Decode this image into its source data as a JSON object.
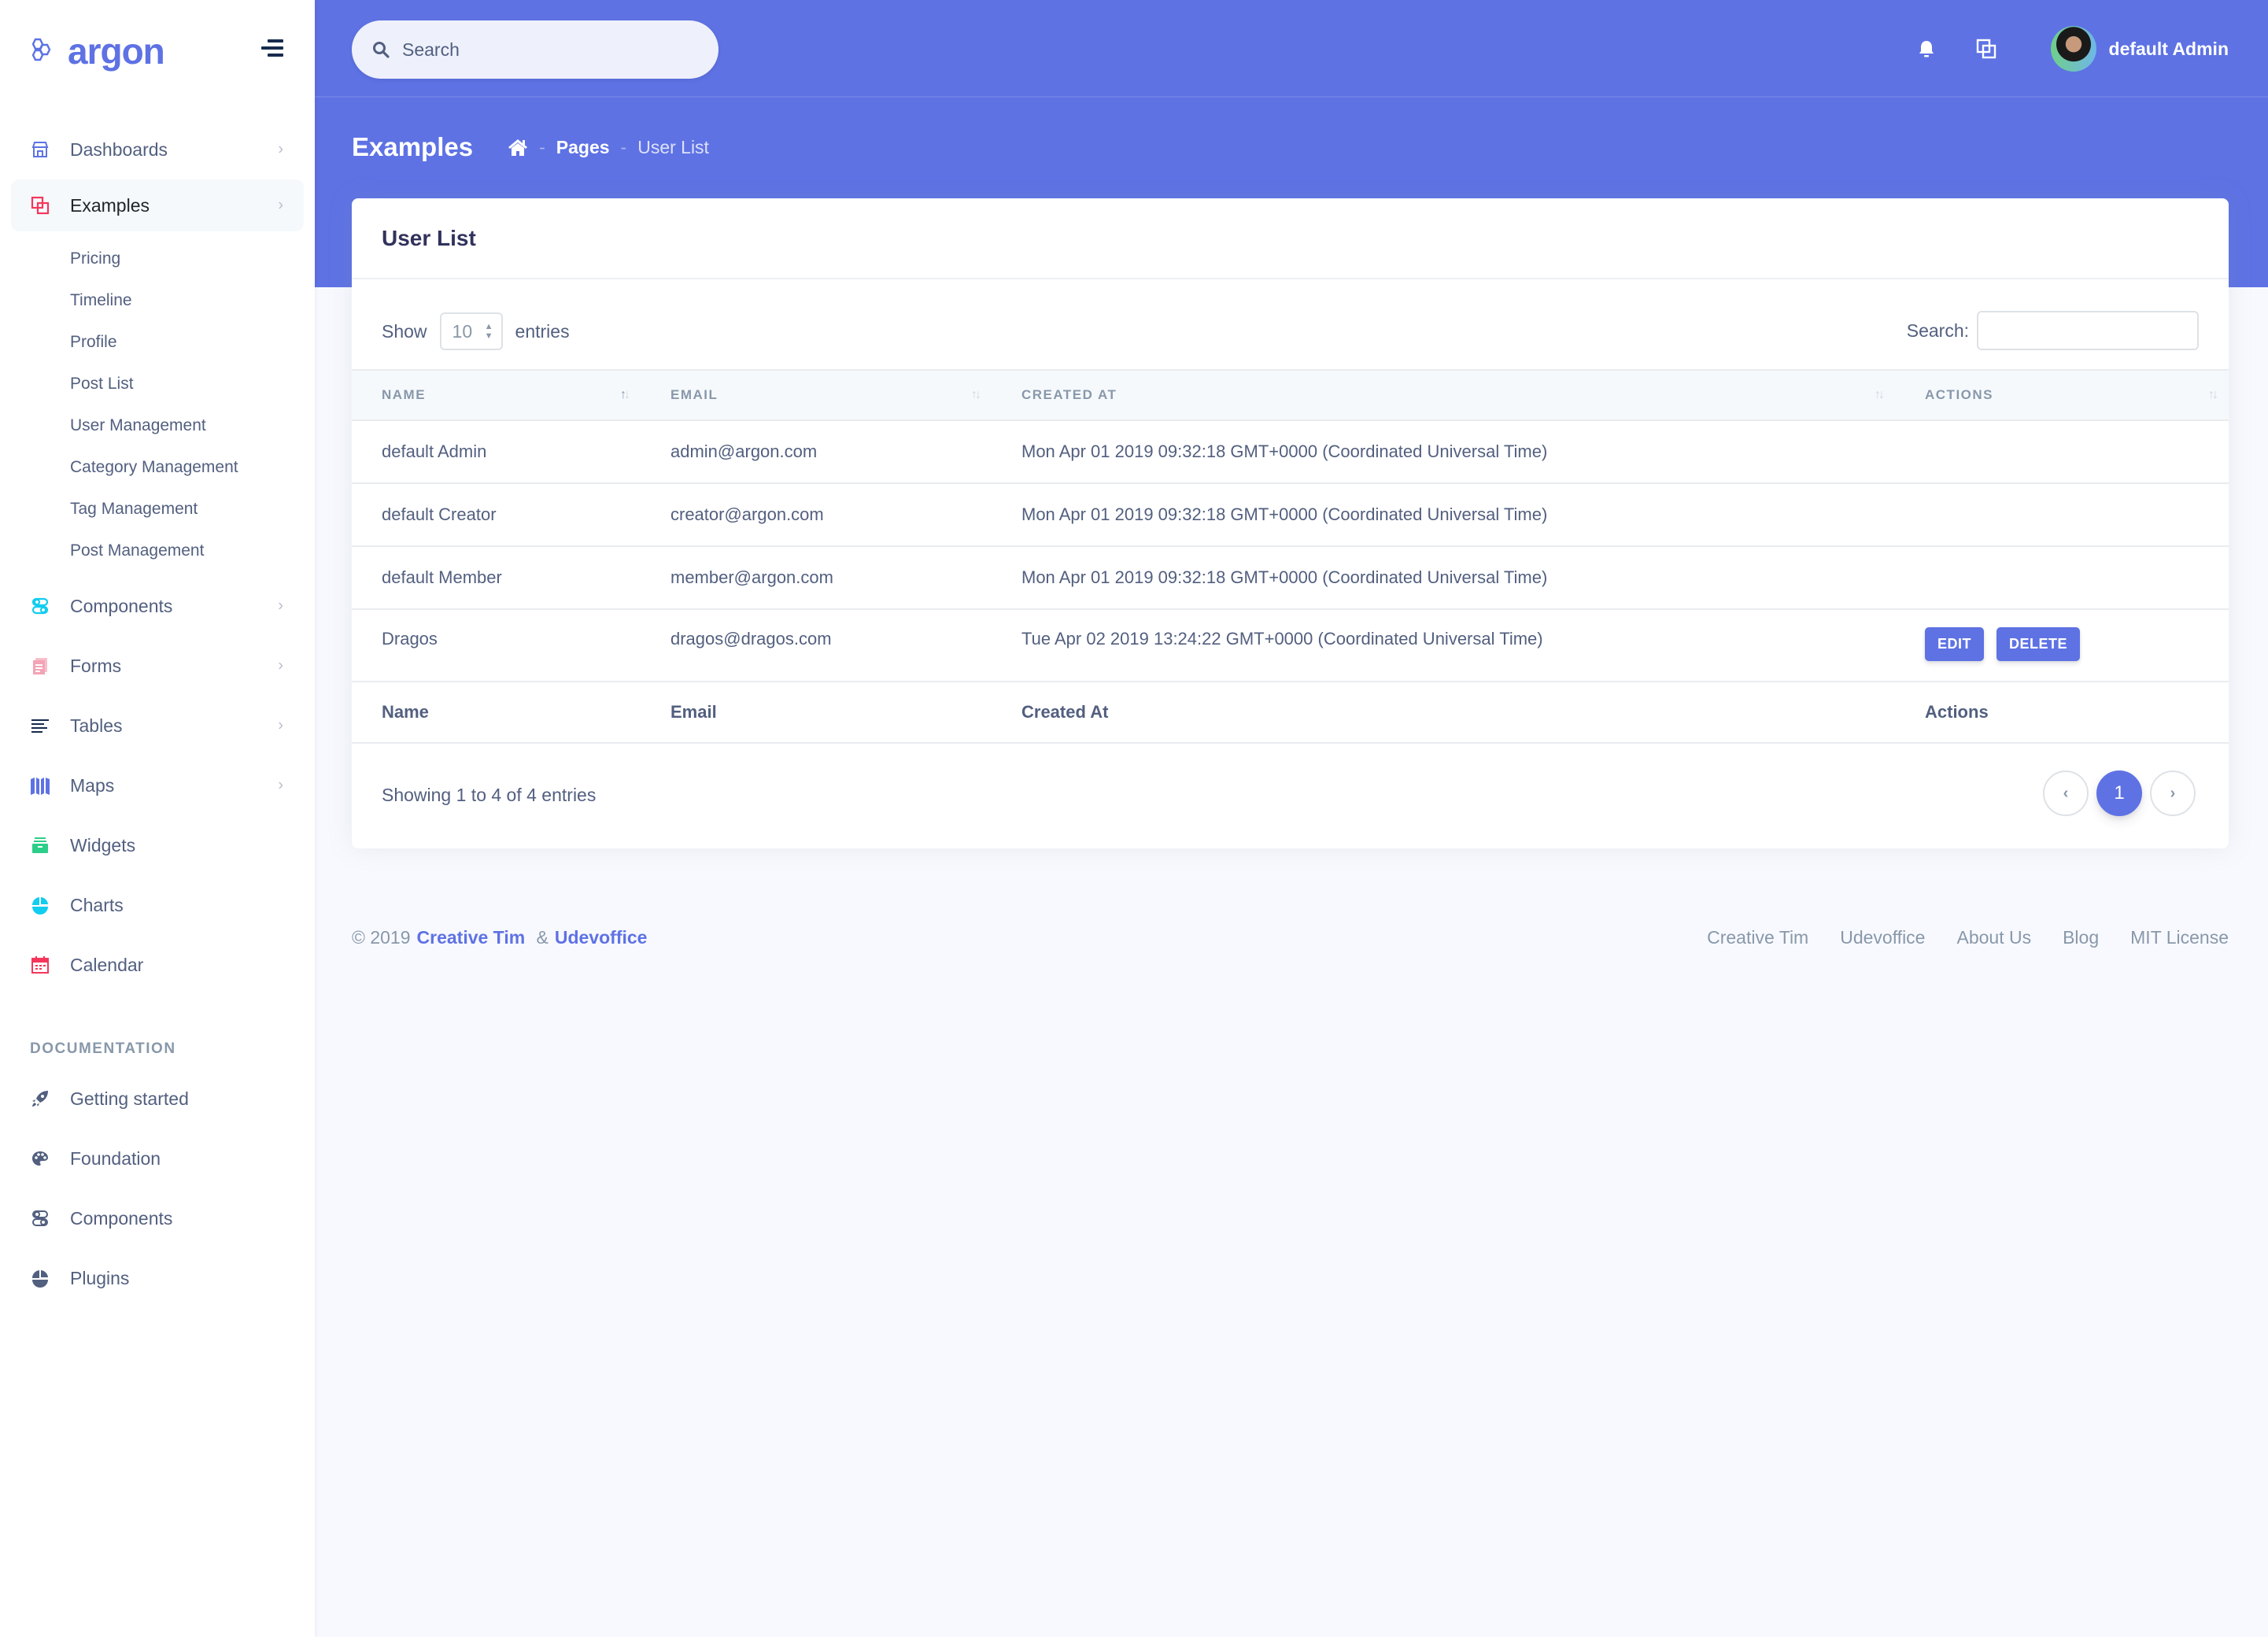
{
  "brand": {
    "name": "argon",
    "logo_icon": "hexagons-icon"
  },
  "sidebar": {
    "toggle_icon": "sidenav-toggler-icon",
    "items": [
      {
        "label": "Dashboards",
        "icon": "shop-icon",
        "color": "#5e72e4",
        "has_chevron": true
      },
      {
        "label": "Examples",
        "icon": "ungroup-icon",
        "color": "#f5365c",
        "has_chevron": true,
        "active": true,
        "children": [
          "Pricing",
          "Timeline",
          "Profile",
          "Post List",
          "User Management",
          "Category Management",
          "Tag Management",
          "Post Management"
        ]
      },
      {
        "label": "Components",
        "icon": "ui-04-icon",
        "color": "#11cdef",
        "has_chevron": true
      },
      {
        "label": "Forms",
        "icon": "single-copy-icon",
        "color": "#f3a4b5",
        "has_chevron": true
      },
      {
        "label": "Tables",
        "icon": "align-left-icon",
        "color": "#172b4d",
        "has_chevron": true
      },
      {
        "label": "Maps",
        "icon": "map-big-icon",
        "color": "#5e72e4",
        "has_chevron": true
      },
      {
        "label": "Widgets",
        "icon": "archive-icon",
        "color": "#2dce89",
        "has_chevron": false
      },
      {
        "label": "Charts",
        "icon": "chart-pie-icon",
        "color": "#11cdef",
        "has_chevron": false
      },
      {
        "label": "Calendar",
        "icon": "calendar-icon",
        "color": "#f5365c",
        "has_chevron": false
      }
    ],
    "doc_heading": "DOCUMENTATION",
    "doc_items": [
      {
        "label": "Getting started",
        "icon": "spaceship-icon"
      },
      {
        "label": "Foundation",
        "icon": "palette-icon"
      },
      {
        "label": "Components",
        "icon": "ui-04-icon"
      },
      {
        "label": "Plugins",
        "icon": "chart-pie-icon"
      }
    ]
  },
  "topnav": {
    "search_placeholder": "Search",
    "user_name": "default Admin"
  },
  "header": {
    "title": "Examples",
    "breadcrumb": [
      "Pages",
      "User List"
    ],
    "breadcrumb_separator": "-"
  },
  "card": {
    "title": "User List",
    "show_label": "Show",
    "entries_label": "entries",
    "page_size": "10",
    "search_label": "Search:",
    "search_value": "",
    "columns": [
      "NAME",
      "EMAIL",
      "CREATED AT",
      "ACTIONS"
    ],
    "footer_columns": [
      "Name",
      "Email",
      "Created At",
      "Actions"
    ],
    "rows": [
      {
        "name": "default Admin",
        "email": "admin@argon.com",
        "created_at": "Mon Apr 01 2019 09:32:18 GMT+0000 (Coordinated Universal Time)",
        "actions": []
      },
      {
        "name": "default Creator",
        "email": "creator@argon.com",
        "created_at": "Mon Apr 01 2019 09:32:18 GMT+0000 (Coordinated Universal Time)",
        "actions": []
      },
      {
        "name": "default Member",
        "email": "member@argon.com",
        "created_at": "Mon Apr 01 2019 09:32:18 GMT+0000 (Coordinated Universal Time)",
        "actions": []
      },
      {
        "name": "Dragos",
        "email": "dragos@dragos.com",
        "created_at": "Tue Apr 02 2019 13:24:22 GMT+0000 (Coordinated Universal Time)",
        "actions": [
          "EDIT",
          "DELETE"
        ]
      }
    ],
    "showing_text": "Showing 1 to 4 of 4 entries",
    "pagination": {
      "prev": "‹",
      "pages": [
        "1"
      ],
      "current": "1",
      "next": "›"
    }
  },
  "footer": {
    "copyright": "© 2019",
    "link1": "Creative Tim",
    "amp": "&",
    "link2": "Udevoffice",
    "links": [
      "Creative Tim",
      "Udevoffice",
      "About Us",
      "Blog",
      "MIT License"
    ]
  },
  "colors": {
    "primary": "#5e72e4",
    "background": "#f8f9fe",
    "text": "#525f7f",
    "muted": "#8898aa"
  }
}
